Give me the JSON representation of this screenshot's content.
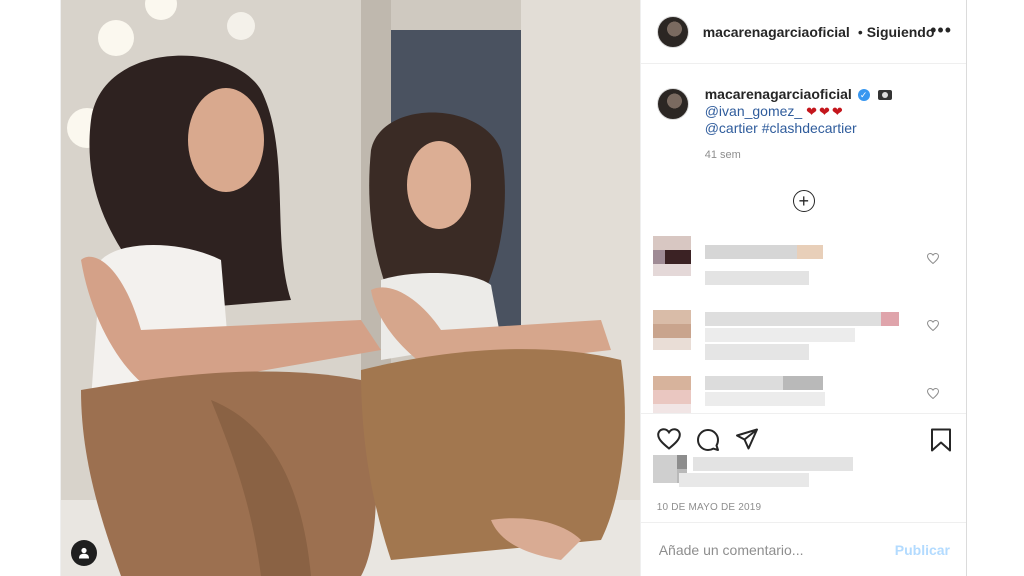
{
  "post": {
    "header": {
      "username": "macarenagarciaoficial",
      "separator": "•",
      "follow_status": "Siguiendo",
      "more_label": "•••"
    },
    "caption": {
      "username": "macarenagarciaoficial",
      "verified_mark": "✓",
      "mention_1": "@ivan_gomez_",
      "hearts": "❤❤❤",
      "mention_2": "@cartier",
      "hashtag": "#clashdecartier",
      "time_ago": "41 sem"
    },
    "load_more_label": "+",
    "date": "10 DE MAYO DE 2019",
    "comment_box": {
      "placeholder": "Añade un comentario...",
      "publish_label": "Publicar"
    },
    "icons": {
      "like": "heart-icon",
      "comment": "comment-icon",
      "share": "paper-plane-icon",
      "save": "bookmark-icon",
      "tagged_users": "user-icon",
      "more": "ellipsis-icon"
    }
  }
}
